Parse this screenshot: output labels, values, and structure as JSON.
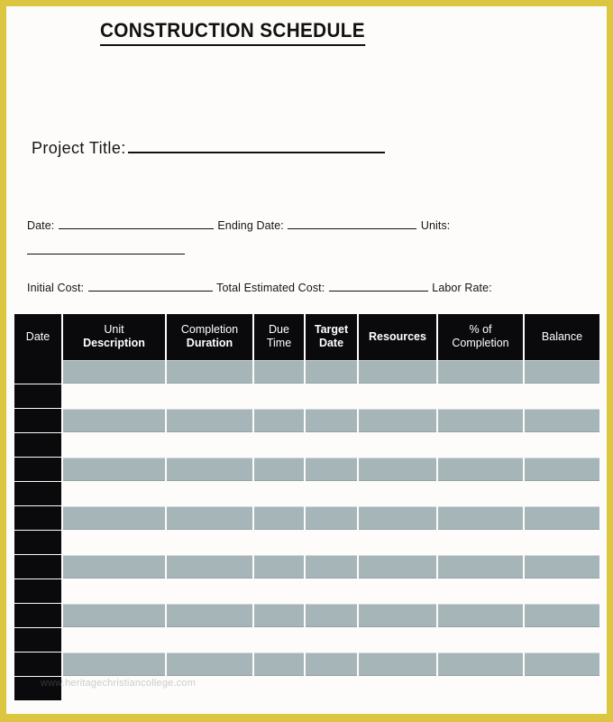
{
  "document": {
    "title": "CONSTRUCTION SCHEDULE"
  },
  "theme": {
    "border_color": "#dcc53f",
    "page_background": "#fdfcfa",
    "header_background": "#0a0a0c",
    "header_text_color": "#ffffff",
    "row_shaded_fill": "#a6b5b8",
    "row_plain_fill": "#fdfcfa",
    "date_cell_fill": "#0a0a0c",
    "text_color": "#151515"
  },
  "fields": {
    "project_title_label": "Project Title:",
    "date_label": "Date:",
    "ending_date_label": "Ending Date:",
    "units_label": "Units:",
    "initial_cost_label": "Initial Cost:",
    "total_estimated_cost_label": "Total Estimated Cost:",
    "labor_rate_label": "Labor Rate:",
    "project_title_value": "",
    "date_value": "",
    "ending_date_value": "",
    "units_value": "",
    "initial_cost_value": "",
    "total_estimated_cost_value": "",
    "labor_rate_value": ""
  },
  "table": {
    "columns": [
      {
        "key": "date",
        "line1": "Date",
        "line2": "",
        "line1_bold": false,
        "line2_bold": false
      },
      {
        "key": "unit_desc",
        "line1": "Unit",
        "line2": "Description",
        "line1_bold": false,
        "line2_bold": true
      },
      {
        "key": "completion",
        "line1": "Completion",
        "line2": "Duration",
        "line1_bold": false,
        "line2_bold": true
      },
      {
        "key": "due_time",
        "line1": "Due",
        "line2": "Time",
        "line1_bold": false,
        "line2_bold": false
      },
      {
        "key": "target_date",
        "line1": "Target",
        "line2": "Date",
        "line1_bold": true,
        "line2_bold": true
      },
      {
        "key": "resources",
        "line1": "Resources",
        "line2": "",
        "line1_bold": true,
        "line2_bold": false
      },
      {
        "key": "pct_compl",
        "line1": "% of",
        "line2": "Completion",
        "line1_bold": false,
        "line2_bold": false
      },
      {
        "key": "balance",
        "line1": "Balance",
        "line2": "",
        "line1_bold": false,
        "line2_bold": false
      }
    ],
    "row_count": 14,
    "rows": [
      {
        "shaded": true,
        "date": "",
        "unit_desc": "",
        "completion": "",
        "due_time": "",
        "target_date": "",
        "resources": "",
        "pct_compl": "",
        "balance": ""
      },
      {
        "shaded": false,
        "date": "",
        "unit_desc": "",
        "completion": "",
        "due_time": "",
        "target_date": "",
        "resources": "",
        "pct_compl": "",
        "balance": ""
      },
      {
        "shaded": true,
        "date": "",
        "unit_desc": "",
        "completion": "",
        "due_time": "",
        "target_date": "",
        "resources": "",
        "pct_compl": "",
        "balance": ""
      },
      {
        "shaded": false,
        "date": "",
        "unit_desc": "",
        "completion": "",
        "due_time": "",
        "target_date": "",
        "resources": "",
        "pct_compl": "",
        "balance": ""
      },
      {
        "shaded": true,
        "date": "",
        "unit_desc": "",
        "completion": "",
        "due_time": "",
        "target_date": "",
        "resources": "",
        "pct_compl": "",
        "balance": ""
      },
      {
        "shaded": false,
        "date": "",
        "unit_desc": "",
        "completion": "",
        "due_time": "",
        "target_date": "",
        "resources": "",
        "pct_compl": "",
        "balance": ""
      },
      {
        "shaded": true,
        "date": "",
        "unit_desc": "",
        "completion": "",
        "due_time": "",
        "target_date": "",
        "resources": "",
        "pct_compl": "",
        "balance": ""
      },
      {
        "shaded": false,
        "date": "",
        "unit_desc": "",
        "completion": "",
        "due_time": "",
        "target_date": "",
        "resources": "",
        "pct_compl": "",
        "balance": ""
      },
      {
        "shaded": true,
        "date": "",
        "unit_desc": "",
        "completion": "",
        "due_time": "",
        "target_date": "",
        "resources": "",
        "pct_compl": "",
        "balance": ""
      },
      {
        "shaded": false,
        "date": "",
        "unit_desc": "",
        "completion": "",
        "due_time": "",
        "target_date": "",
        "resources": "",
        "pct_compl": "",
        "balance": ""
      },
      {
        "shaded": true,
        "date": "",
        "unit_desc": "",
        "completion": "",
        "due_time": "",
        "target_date": "",
        "resources": "",
        "pct_compl": "",
        "balance": ""
      },
      {
        "shaded": false,
        "date": "",
        "unit_desc": "",
        "completion": "",
        "due_time": "",
        "target_date": "",
        "resources": "",
        "pct_compl": "",
        "balance": ""
      },
      {
        "shaded": true,
        "date": "",
        "unit_desc": "",
        "completion": "",
        "due_time": "",
        "target_date": "",
        "resources": "",
        "pct_compl": "",
        "balance": ""
      },
      {
        "shaded": false,
        "date": "",
        "unit_desc": "",
        "completion": "",
        "due_time": "",
        "target_date": "",
        "resources": "",
        "pct_compl": "",
        "balance": ""
      }
    ]
  },
  "watermark": {
    "text": "www.heritagechristiancollege.com"
  }
}
